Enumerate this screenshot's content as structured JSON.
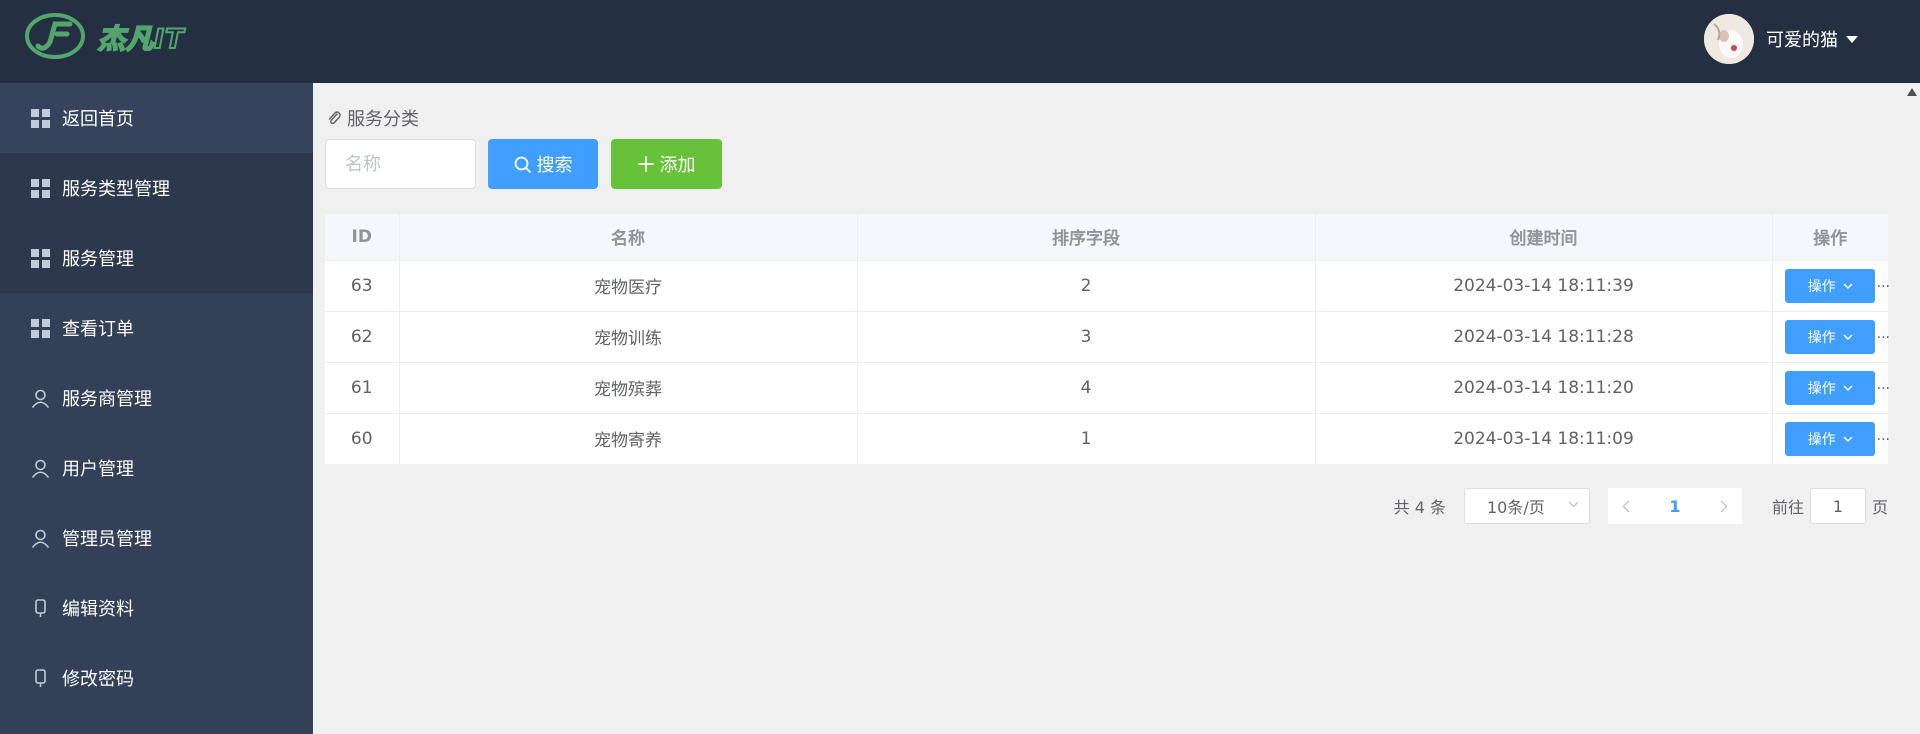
{
  "header": {
    "brand": "杰凡IT",
    "user_name": "可爱的猫",
    "icons": {
      "logo": "jf-logo",
      "avatar": "cat-avatar",
      "caret": "caret-down-icon"
    }
  },
  "sidebar": {
    "items": [
      {
        "label": "返回首页",
        "icon": "grid-icon"
      },
      {
        "label": "服务类型管理",
        "icon": "grid-icon"
      },
      {
        "label": "服务管理",
        "icon": "grid-icon"
      },
      {
        "label": "查看订单",
        "icon": "grid-icon"
      },
      {
        "label": "服务商管理",
        "icon": "user-icon"
      },
      {
        "label": "用户管理",
        "icon": "user-icon"
      },
      {
        "label": "管理员管理",
        "icon": "user-icon"
      },
      {
        "label": "编辑资料",
        "icon": "phone-icon"
      },
      {
        "label": "修改密码",
        "icon": "phone-icon"
      }
    ]
  },
  "main": {
    "breadcrumb": "服务分类",
    "search": {
      "placeholder": "名称",
      "value": ""
    },
    "search_button": "搜索",
    "add_button": "添加",
    "table": {
      "columns": [
        "ID",
        "名称",
        "排序字段",
        "创建时间",
        "操作"
      ],
      "rows": [
        {
          "id": "63",
          "name": "宠物医疗",
          "sort": "2",
          "created": "2024-03-14 18:11:39",
          "op": "操作"
        },
        {
          "id": "62",
          "name": "宠物训练",
          "sort": "3",
          "created": "2024-03-14 18:11:28",
          "op": "操作"
        },
        {
          "id": "61",
          "name": "宠物殡葬",
          "sort": "4",
          "created": "2024-03-14 18:11:20",
          "op": "操作"
        },
        {
          "id": "60",
          "name": "宠物寄养",
          "sort": "1",
          "created": "2024-03-14 18:11:09",
          "op": "操作"
        }
      ],
      "overflow_marker": "..."
    },
    "pagination": {
      "total": "共 4 条",
      "page_size": "10条/页",
      "current_page": "1",
      "goto_label": "前往",
      "goto_value": "1",
      "page_unit": "页"
    }
  },
  "colors": {
    "header_bg": "#242f42",
    "sidebar_bg": "#324157",
    "primary": "#409eff",
    "success": "#67c23a",
    "brand_green": "#52a66d"
  }
}
